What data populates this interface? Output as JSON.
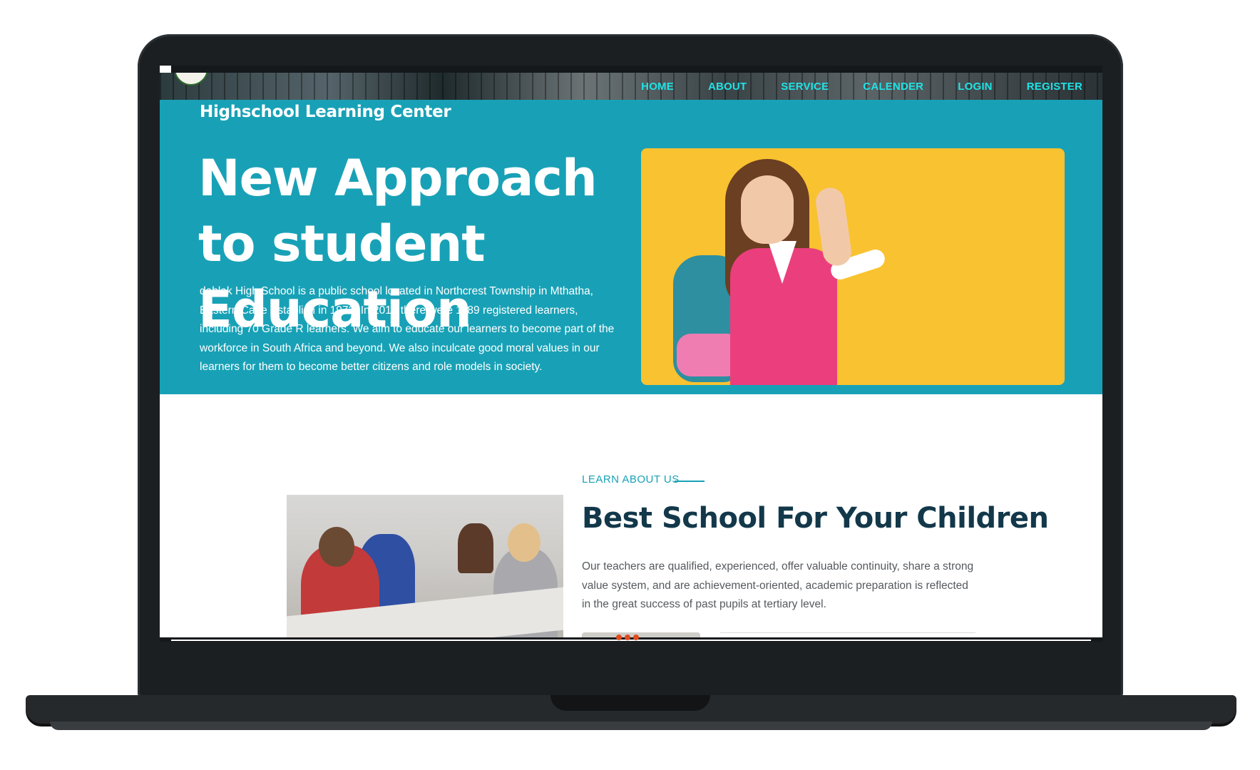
{
  "nav": {
    "links": [
      "HOME",
      "ABOUT",
      "SERVICE",
      "CALENDER",
      "LOGIN",
      "REGISTER"
    ]
  },
  "hero": {
    "school_name": "Highschool Learning Center",
    "title": "New Approach to student Education",
    "text": "dahlak High School is a public school located in Northcrest Township in Mthatha, Eastern Cape Establish in 1972. In 2014 there were 1189 registered learners, including 70 Grade R learners. We aim to educate our learners to become part of the workforce in South Africa and beyond. We also inculcate good moral values in our learners for them to become better citizens and role models in society."
  },
  "about": {
    "label": "LEARN ABOUT US",
    "title": "Best School For Your Children",
    "text": "Our teachers are qualified, experienced, offer valuable continuity, share a strong value system, and are achievement-oriented, academic preparation is reflected in the great success of past pupils at tertiary level."
  },
  "colors": {
    "hero_bg": "#18a1b6",
    "nav_link": "#1fe3e6",
    "title_dark": "#12384a",
    "hero_image_bg": "#f9c230",
    "accent": "#e24b1e"
  }
}
